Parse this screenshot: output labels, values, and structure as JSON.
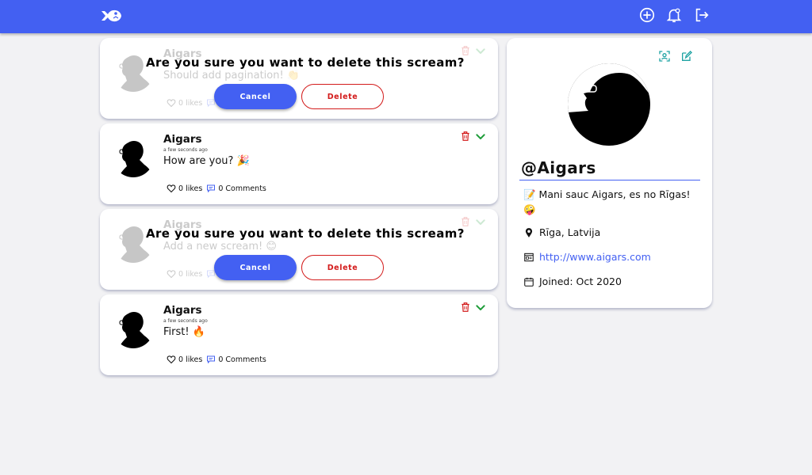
{
  "navbar": {
    "icons": [
      "fish-logo-icon",
      "add-scream-icon",
      "notifications-icon",
      "logout-icon"
    ],
    "brand_color": "#4360f2"
  },
  "screams": [
    {
      "user": "Aigars",
      "date": "",
      "body": "Should add pagination! 👏",
      "likes": "0 likes",
      "comments": "",
      "confirm": {
        "question": "Are you sure you want to delete this scream?",
        "cancel": "Cancel",
        "delete": "Delete"
      }
    },
    {
      "user": "Aigars",
      "date": "a few seconds ago",
      "body": "How are you? 🎉",
      "likes": "0 likes",
      "comments": "0 Comments"
    },
    {
      "user": "Aigars",
      "date": "",
      "body": "Add a new scream! 😊",
      "likes": "0 likes",
      "comments": "",
      "confirm": {
        "question": "Are you sure you want to delete this scream?",
        "cancel": "Cancel",
        "delete": "Delete"
      }
    },
    {
      "user": "Aigars",
      "date": "a few seconds ago",
      "body": "First! 🔥",
      "likes": "0 likes",
      "comments": "0 Comments"
    }
  ],
  "profile": {
    "at_sign": "@",
    "handle": "Aigars",
    "bio": "📝 Mani sauc Aigars, es no Rīgas! 🤪",
    "location": "Rīga, Latvija",
    "website": "http://www.aigars.com",
    "joined": "Joined: Oct 2020"
  },
  "colors": {
    "accent": "#4360f2",
    "danger": "#d31b1b",
    "success": "#1f9d3a"
  }
}
